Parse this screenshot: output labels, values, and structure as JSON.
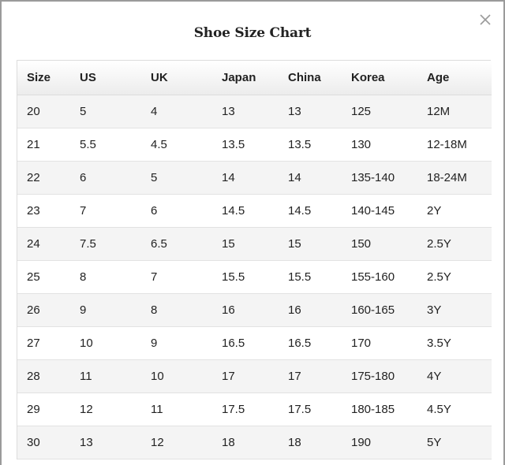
{
  "dialog": {
    "title": "Shoe Size Chart",
    "close_icon": "close-icon"
  },
  "table": {
    "columns": [
      "Size",
      "US",
      "UK",
      "Japan",
      "China",
      "Korea",
      "Age"
    ],
    "rows": [
      [
        "20",
        "5",
        "4",
        "13",
        "13",
        "125",
        "12M"
      ],
      [
        "21",
        "5.5",
        "4.5",
        "13.5",
        "13.5",
        "130",
        "12-18M"
      ],
      [
        "22",
        "6",
        "5",
        "14",
        "14",
        "135-140",
        "18-24M"
      ],
      [
        "23",
        "7",
        "6",
        "14.5",
        "14.5",
        "140-145",
        "2Y"
      ],
      [
        "24",
        "7.5",
        "6.5",
        "15",
        "15",
        "150",
        "2.5Y"
      ],
      [
        "25",
        "8",
        "7",
        "15.5",
        "15.5",
        "155-160",
        "2.5Y"
      ],
      [
        "26",
        "9",
        "8",
        "16",
        "16",
        "160-165",
        "3Y"
      ],
      [
        "27",
        "10",
        "9",
        "16.5",
        "16.5",
        "170",
        "3.5Y"
      ],
      [
        "28",
        "11",
        "10",
        "17",
        "17",
        "175-180",
        "4Y"
      ],
      [
        "29",
        "12",
        "11",
        "17.5",
        "17.5",
        "180-185",
        "4.5Y"
      ],
      [
        "30",
        "13",
        "12",
        "18",
        "18",
        "190",
        "5Y"
      ]
    ]
  },
  "colors": {
    "header_gradient_top": "#ffffff",
    "header_gradient_bottom": "#ececec",
    "stripe": "#f4f4f4",
    "border": "#dcdcdc",
    "text": "#222222"
  }
}
